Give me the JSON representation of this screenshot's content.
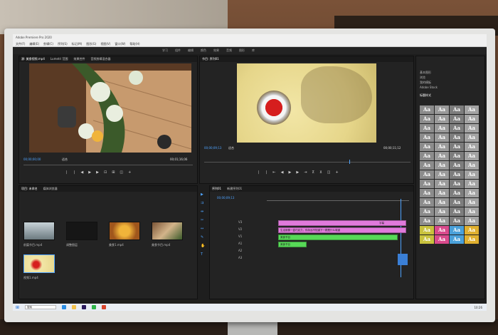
{
  "app": {
    "title": "Adobe Premiere Pro 2020",
    "menu": [
      "文件(F)",
      "编辑(E)",
      "剪辑(C)",
      "序列(S)",
      "标记(M)",
      "图形(G)",
      "视图(V)",
      "窗口(W)",
      "帮助(H)"
    ],
    "workspaces": [
      "学习",
      "组件",
      "编辑",
      "颜色",
      "效果",
      "音频",
      "图形",
      "库"
    ]
  },
  "source_panel": {
    "title": "源: 美食视频.mp4",
    "tabs": [
      "Lumetri 范围",
      "效果控件",
      "音频剪辑混合器"
    ],
    "timecode_left": "00;00;00;00",
    "fit": "适合",
    "timecode_right": "00;01;16;06"
  },
  "program_panel": {
    "title": "节目: 序列01",
    "timecode_left": "00;00;09;13",
    "fit": "适合",
    "timecode_right": "00;00;11;12"
  },
  "project_panel": {
    "tabs": [
      "项目: 未命名",
      "媒体浏览器"
    ],
    "items": [
      {
        "label": "前篇节目.mp4"
      },
      {
        "label": "调整图层"
      },
      {
        "label": "美食1.mp4"
      },
      {
        "label": "美食节目.mp4"
      },
      {
        "label": "视频1.mp4"
      }
    ]
  },
  "timeline": {
    "tab": "序列01",
    "other_tab": "新建序列01",
    "timecode": "00;00;09;13",
    "tracks": [
      "V3",
      "V2",
      "V1",
      "A1",
      "A2",
      "A3"
    ],
    "clips": [
      {
        "label": "字幕",
        "color": "#e07adb"
      },
      {
        "label": "生活就像一盒巧克力，你永远不知道下一颗是什么味道",
        "color": "#e07adb"
      },
      {
        "label": "美食节目",
        "color": "#57d957"
      },
      {
        "label": "美食节目",
        "color": "#57d957"
      }
    ]
  },
  "essential_graphics": {
    "items": [
      "基本图形",
      "浏览",
      "我的模板",
      "Adobe Stock"
    ],
    "heading": "标题样式"
  },
  "aa_tiles": 60,
  "taskbar": {
    "search": "搜索",
    "time": "10:26"
  }
}
